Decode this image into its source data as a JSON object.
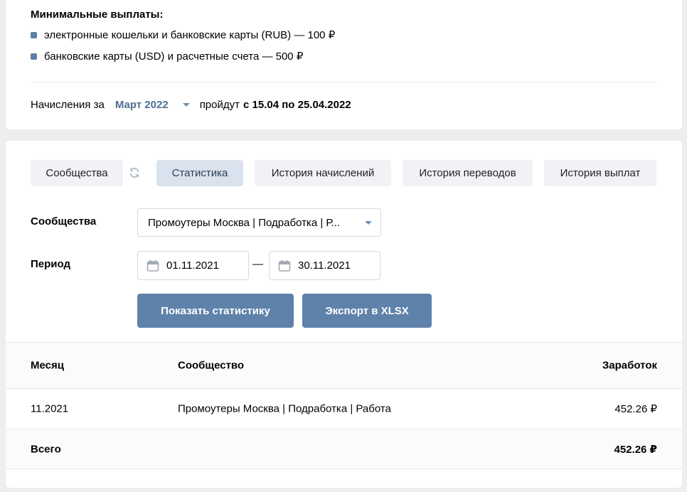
{
  "payouts": {
    "title": "Минимальные выплаты:",
    "items": [
      "электронные кошельки и банковские карты (RUB) — 100 ₽",
      "банковские карты (USD) и расчетные счета — 500 ₽"
    ]
  },
  "accrual": {
    "prefix": "Начисления за",
    "month": "Март 2022",
    "middle": "пройдут",
    "range": "с 15.04 по 25.04.2022"
  },
  "tabs": [
    {
      "label": "Сообщества",
      "active": false
    },
    {
      "label": "Статистика",
      "active": true
    },
    {
      "label": "История начислений",
      "active": false
    },
    {
      "label": "История переводов",
      "active": false
    },
    {
      "label": "История выплат",
      "active": false
    }
  ],
  "filters": {
    "community_label": "Сообщества",
    "community_value": "Промоутеры Москва | Подработка | Р...",
    "period_label": "Период",
    "date_from": "01.11.2021",
    "date_separator": "—",
    "date_to": "30.11.2021"
  },
  "buttons": {
    "show": "Показать статистику",
    "export": "Экспорт в XLSX"
  },
  "table": {
    "headers": [
      "Месяц",
      "Сообщество",
      "Заработок"
    ],
    "rows": [
      {
        "month": "11.2021",
        "community": "Промоутеры Москва | Подработка | Работа",
        "earnings": "452.26 ₽"
      }
    ],
    "total": {
      "label": "Всего",
      "earnings": "452.26 ₽"
    }
  },
  "colors": {
    "accent": "#5f82aa",
    "link": "#4f6f91",
    "active_tab_bg": "#dae2ed",
    "tab_bg": "#f0f2f5",
    "page_bg": "#edeef0"
  }
}
